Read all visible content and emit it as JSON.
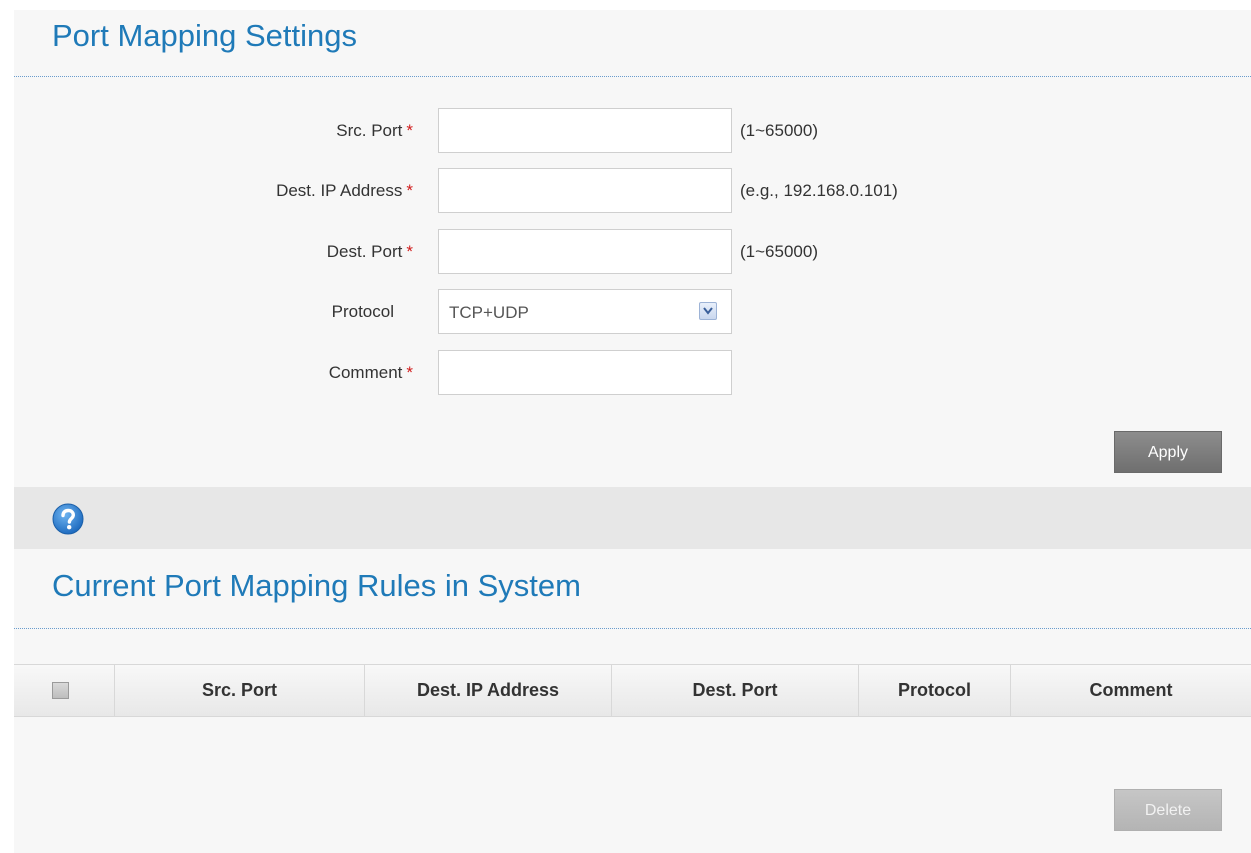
{
  "settings": {
    "title": "Port Mapping Settings",
    "fields": {
      "src_port": {
        "label": "Src. Port",
        "required": "*",
        "value": "",
        "hint": "(1~65000)"
      },
      "dest_ip": {
        "label": "Dest. IP Address",
        "required": "*",
        "value": "",
        "hint": "(e.g., 192.168.0.101)"
      },
      "dest_port": {
        "label": "Dest. Port",
        "required": "*",
        "value": "",
        "hint": "(1~65000)"
      },
      "protocol": {
        "label": "Protocol",
        "selected": "TCP+UDP"
      },
      "comment": {
        "label": "Comment",
        "required": "*",
        "value": ""
      }
    },
    "apply_label": "Apply"
  },
  "help": {
    "icon": "question-mark-icon",
    "color": "#2a7fd0"
  },
  "rules": {
    "title": "Current Port Mapping Rules in System",
    "columns": [
      "Src. Port",
      "Dest. IP Address",
      "Dest. Port",
      "Protocol",
      "Comment"
    ],
    "rows": [],
    "delete_label": "Delete"
  },
  "colors": {
    "title": "#1f7ab8",
    "required": "#d01a1a",
    "apply_bg": "#7d7d7d",
    "delete_bg": "#bdbdbd"
  }
}
